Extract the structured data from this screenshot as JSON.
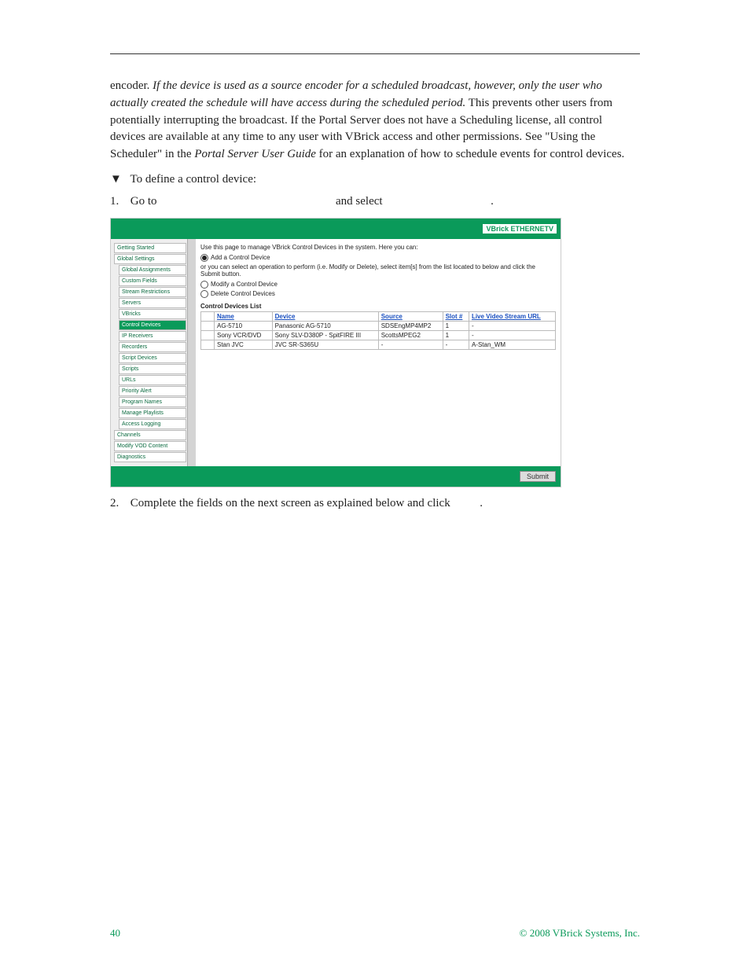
{
  "body": {
    "intro_prefix": "encoder. ",
    "intro_italic": "If the device is used as a source encoder for a scheduled broadcast, however, only the user who actually created the schedule will have access during the scheduled period.",
    "intro_rest": " This prevents other users from potentially interrupting the broadcast. If the Portal Server does not have a Scheduling license, all control devices are available at any time to any user with VBrick access and other permissions. See \"Using the Scheduler\" in the ",
    "intro_guide_italic": "Portal Server User Guide",
    "intro_tail": " for an explanation of how to schedule events for control devices.",
    "step_define": "To define a control device:",
    "step1_a": "Go to",
    "step1_b": "and select",
    "step1_c": ".",
    "step2": "Complete the fields on the next screen as explained below and click",
    "step2_tail": "."
  },
  "shot": {
    "logo": "VBrick ETHERNETV",
    "nav": [
      {
        "label": "Getting Started",
        "sub": false
      },
      {
        "label": "Global Settings",
        "sub": false
      },
      {
        "label": "Global Assignments",
        "sub": true
      },
      {
        "label": "Custom Fields",
        "sub": true
      },
      {
        "label": "Stream Restrictions",
        "sub": true
      },
      {
        "label": "Servers",
        "sub": true
      },
      {
        "label": "VBricks",
        "sub": true
      },
      {
        "label": "Control Devices",
        "sub": true,
        "active": true
      },
      {
        "label": "IP Receivers",
        "sub": true
      },
      {
        "label": "Recorders",
        "sub": true
      },
      {
        "label": "Script Devices",
        "sub": true
      },
      {
        "label": "Scripts",
        "sub": true
      },
      {
        "label": "URLs",
        "sub": true
      },
      {
        "label": "Priority Alert",
        "sub": true
      },
      {
        "label": "Program Names",
        "sub": true
      },
      {
        "label": "Manage Playlists",
        "sub": true
      },
      {
        "label": "Access Logging",
        "sub": true
      },
      {
        "label": "Channels",
        "sub": false
      },
      {
        "label": "Modify VOD Content",
        "sub": false
      },
      {
        "label": "Diagnostics",
        "sub": false
      }
    ],
    "intro": "Use this page to manage VBrick Control Devices in the system. Here you can:",
    "radios": {
      "add": "Add a Control Device",
      "mod": "Modify a Control Device",
      "del": "Delete Control Devices"
    },
    "or_text": "or you can select an operation to perform (i.e. Modify or Delete), select item[s] from the list located to below and click the Submit button.",
    "list_title": "Control Devices List",
    "headers": {
      "name": "Name",
      "device": "Device",
      "source": "Source",
      "slot": "Slot #",
      "url": "Live Video Stream URL"
    },
    "rows": [
      {
        "name": "AG-5710",
        "device": "Panasonic AG-5710",
        "source": "SDSEngMP4MP2",
        "slot": "1",
        "url": "-"
      },
      {
        "name": "Sony VCR/DVD",
        "device": "Sony SLV-D380P - SpitFIRE III",
        "source": "ScottsMPEG2",
        "slot": "1",
        "url": "-"
      },
      {
        "name": "Stan JVC",
        "device": "JVC SR-S365U",
        "source": "-",
        "slot": "-",
        "url": "A-Stan_WM"
      }
    ],
    "submit": "Submit"
  },
  "footer": {
    "page": "40",
    "copyright": "© 2008 VBrick Systems, Inc."
  }
}
